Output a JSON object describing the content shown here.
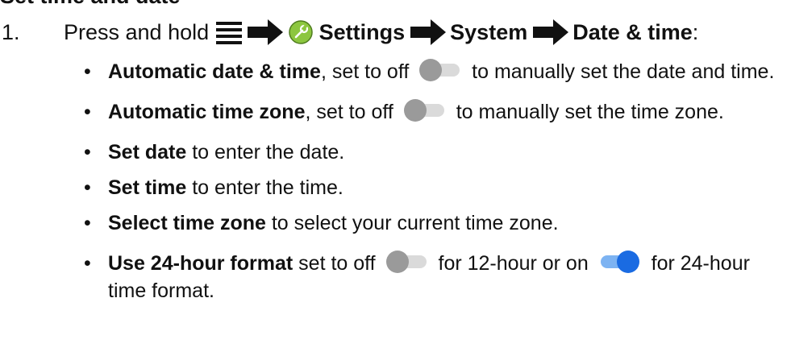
{
  "heading_partial": "Set time and date",
  "step": {
    "number": "1.",
    "intro": "Press and hold",
    "path": [
      "Settings",
      "System",
      "Date & time"
    ],
    "suffix": ":"
  },
  "bullets": [
    {
      "term": "Automatic date & time",
      "before": ", set to off",
      "toggle": "off",
      "after": " to manually set the date and time."
    },
    {
      "term": "Automatic time zone",
      "before": ", set to off",
      "toggle": "off",
      "after": " to manually set the time zone."
    },
    {
      "term": "Set date",
      "after": " to enter the date."
    },
    {
      "term": "Set time",
      "after": " to enter the time."
    },
    {
      "term": "Select time zone",
      "after": " to select your current time zone."
    },
    {
      "term": "Use 24-hour format",
      "before": " set to off",
      "toggle": "off",
      "middle": " for 12-hour or on",
      "toggle2": "on",
      "after": " for 24-hour time format."
    }
  ],
  "colors": {
    "text": "#111111",
    "toggle_off_knob": "#9a9a9a",
    "toggle_off_track": "#dadada",
    "toggle_on_knob": "#1a6be2",
    "toggle_on_track": "#7db3f2",
    "settings_icon": "#8cc63f"
  },
  "icons": {
    "menu": "menu-icon",
    "arrow": "arrow-right-icon",
    "settings": "settings-wrench-icon"
  }
}
